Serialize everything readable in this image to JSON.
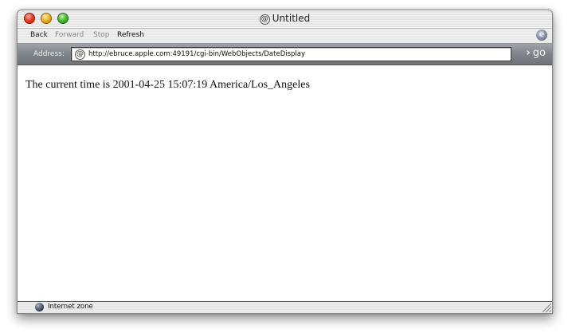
{
  "window": {
    "title": "Untitled",
    "title_icon": "at-sign-icon"
  },
  "toolbar": {
    "back_label": "Back",
    "forward_label": "Forward",
    "stop_label": "Stop",
    "refresh_label": "Refresh",
    "forward_enabled": false,
    "stop_enabled": false
  },
  "address_bar": {
    "label": "Address:",
    "url": "http://ebruce.apple.com:49191/cgi-bin/WebObjects/DateDisplay",
    "go_label": "go"
  },
  "page": {
    "content_text": "The current time is 2001-04-25 15:07:19 America/Los_Angeles"
  },
  "status_bar": {
    "zone_text": "Internet zone"
  }
}
